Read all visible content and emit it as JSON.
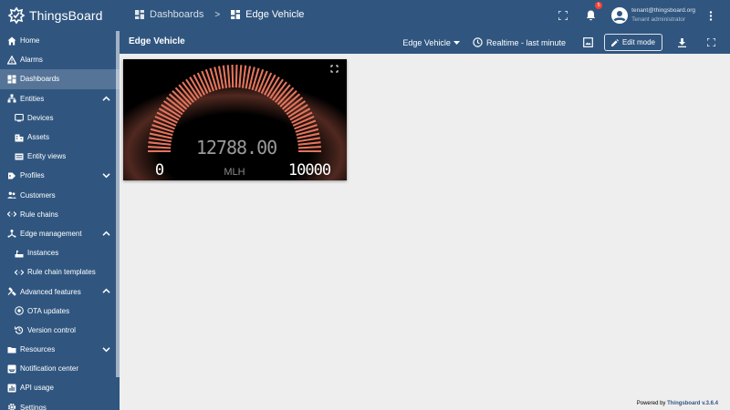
{
  "header": {
    "logo_text": "ThingsBoard",
    "breadcrumb": [
      {
        "label": "Dashboards",
        "icon": "dashboard-icon"
      },
      {
        "label": "Edge Vehicle",
        "icon": "dashboard-icon"
      }
    ],
    "notification_count": "5",
    "user_email": "tenant@thingsboard.org",
    "user_role": "Tenant administrator"
  },
  "sidebar": {
    "items": [
      {
        "label": "Home",
        "icon": "home-icon"
      },
      {
        "label": "Alarms",
        "icon": "alarm-icon"
      },
      {
        "label": "Dashboards",
        "icon": "dashboard-icon",
        "active": true
      },
      {
        "label": "Entities",
        "icon": "entities-icon",
        "expanded": true
      },
      {
        "label": "Devices",
        "icon": "devices-icon",
        "sub": true
      },
      {
        "label": "Assets",
        "icon": "assets-icon",
        "sub": true
      },
      {
        "label": "Entity views",
        "icon": "entity-views-icon",
        "sub": true
      },
      {
        "label": "Profiles",
        "icon": "profiles-icon",
        "expanded": false
      },
      {
        "label": "Customers",
        "icon": "customers-icon"
      },
      {
        "label": "Rule chains",
        "icon": "rule-chains-icon"
      },
      {
        "label": "Edge management",
        "icon": "edge-icon",
        "expanded": true
      },
      {
        "label": "Instances",
        "icon": "instances-icon",
        "sub": true
      },
      {
        "label": "Rule chain templates",
        "icon": "rule-chains-icon",
        "sub": true
      },
      {
        "label": "Advanced features",
        "icon": "advanced-icon",
        "expanded": true
      },
      {
        "label": "OTA updates",
        "icon": "ota-icon",
        "sub": true
      },
      {
        "label": "Version control",
        "icon": "version-control-icon",
        "sub": true
      },
      {
        "label": "Resources",
        "icon": "resources-icon",
        "expanded": false
      },
      {
        "label": "Notification center",
        "icon": "notification-center-icon"
      },
      {
        "label": "API usage",
        "icon": "api-usage-icon"
      },
      {
        "label": "Settings",
        "icon": "settings-icon"
      }
    ]
  },
  "toolbar": {
    "title": "Edge Vehicle",
    "state_label": "Edge Vehicle",
    "timewindow_label": "Realtime - last minute",
    "edit_label": "Edit mode"
  },
  "widget": {
    "value": "12788.00",
    "units": "MLH",
    "min_label": "0",
    "max_label": "10000",
    "level_fraction": 1.0,
    "bar_color": "#e4745c"
  },
  "footer": {
    "powered_by": "Powered by ",
    "brand": "Thingsboard v.3.6.4"
  },
  "colors": {
    "primary": "#305680",
    "background": "#eeeeee"
  }
}
